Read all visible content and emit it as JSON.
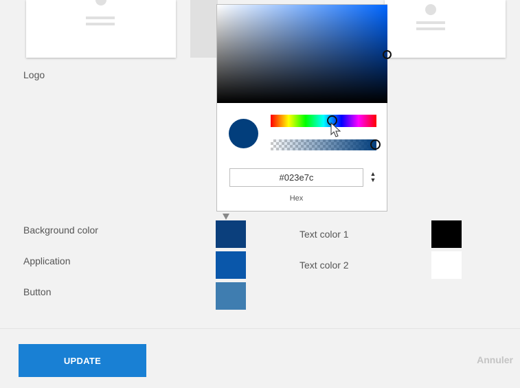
{
  "logo_section": {
    "label": "Logo"
  },
  "colors": {
    "background_color": {
      "label": "Background color",
      "value": "#0b3f7c"
    },
    "application": {
      "label": "Application",
      "value": "#0a57aa"
    },
    "button": {
      "label": "Button",
      "value": "#3f7db0"
    },
    "text_color_1": {
      "label": "Text color 1",
      "value": "#000000"
    },
    "text_color_2": {
      "label": "Text color 2",
      "value": "#ffffff"
    }
  },
  "picker": {
    "hex_value": "#023e7c",
    "format_label": "Hex",
    "current_color": "#023e7c",
    "alpha": 1.0
  },
  "actions": {
    "update_label": "UPDATE",
    "cancel_label": "Annuler"
  },
  "icons": {
    "stepper": "up-down-arrows-icon",
    "cursor": "mouse-pointer-icon",
    "marker": "triangle-down-icon"
  }
}
